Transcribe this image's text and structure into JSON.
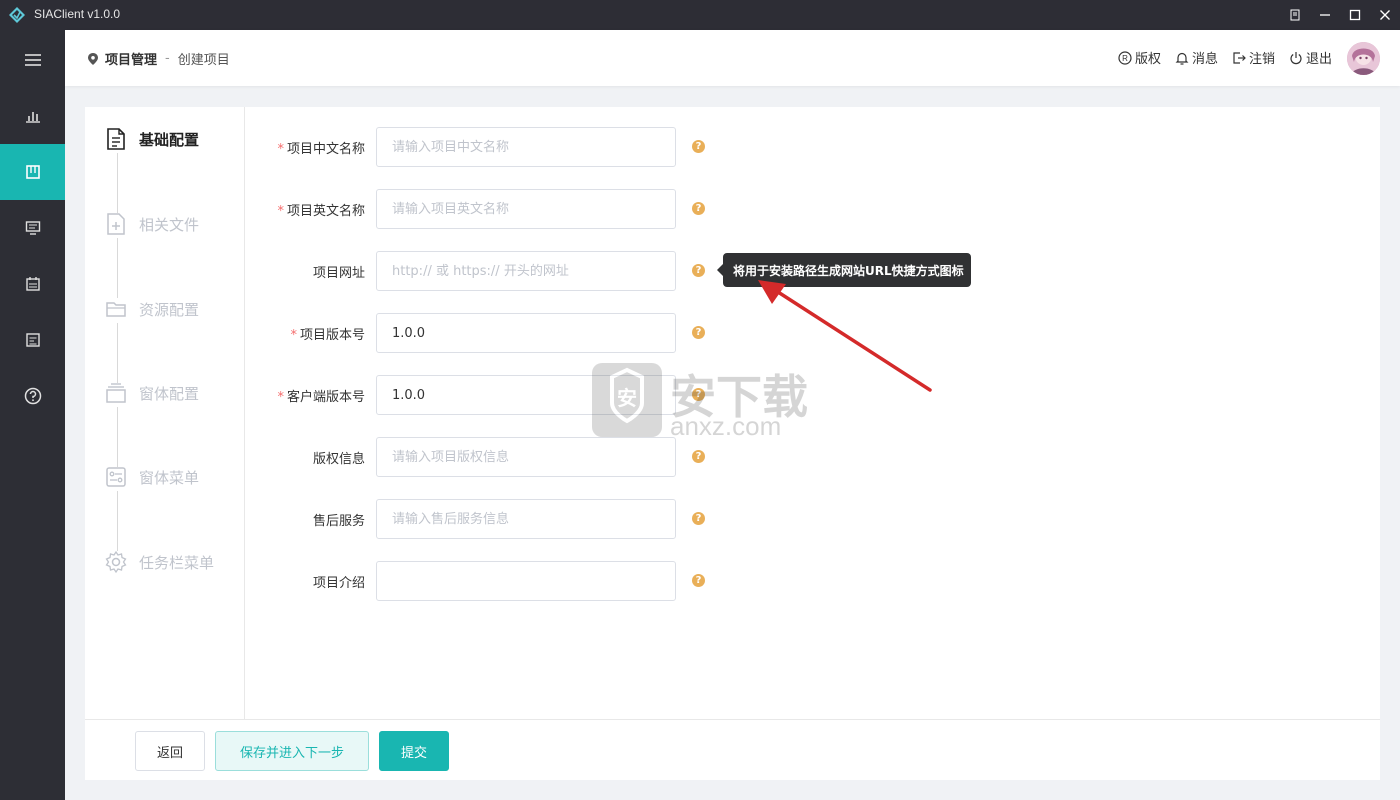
{
  "app": {
    "title": "SIAClient v1.0.0"
  },
  "colors": {
    "accent": "#19b6b1",
    "sidebar": "#2d2e35",
    "required": "#f56c6c",
    "help": "#e6a23c",
    "arrow": "#d42a2a"
  },
  "sidebar": {
    "items": [
      {
        "icon": "menu-icon"
      },
      {
        "icon": "bar-chart-icon"
      },
      {
        "icon": "project-icon",
        "active": true
      },
      {
        "icon": "monitor-icon"
      },
      {
        "icon": "calendar-icon"
      },
      {
        "icon": "document-icon"
      },
      {
        "icon": "help-circle-icon"
      }
    ]
  },
  "header": {
    "breadcrumb": {
      "primary": "项目管理",
      "separator": "-",
      "secondary": "创建项目"
    },
    "actions": [
      {
        "label": "版权",
        "icon": "copyright-icon"
      },
      {
        "label": "消息",
        "icon": "bell-icon"
      },
      {
        "label": "注销",
        "icon": "logout-icon"
      },
      {
        "label": "退出",
        "icon": "power-icon"
      }
    ]
  },
  "steps": [
    {
      "label": "基础配置",
      "icon": "document-icon",
      "active": true
    },
    {
      "label": "相关文件",
      "icon": "file-add-icon"
    },
    {
      "label": "资源配置",
      "icon": "folder-icon"
    },
    {
      "label": "窗体配置",
      "icon": "window-icon"
    },
    {
      "label": "窗体菜单",
      "icon": "menu-settings-icon"
    },
    {
      "label": "任务栏菜单",
      "icon": "gear-icon"
    }
  ],
  "form": {
    "fields": [
      {
        "label": "项目中文名称",
        "required": true,
        "value": "",
        "placeholder": "请输入项目中文名称"
      },
      {
        "label": "项目英文名称",
        "required": true,
        "value": "",
        "placeholder": "请输入项目英文名称"
      },
      {
        "label": "项目网址",
        "required": false,
        "value": "",
        "placeholder": "http:// 或 https:// 开头的网址"
      },
      {
        "label": "项目版本号",
        "required": true,
        "value": "1.0.0",
        "placeholder": ""
      },
      {
        "label": "客户端版本号",
        "required": true,
        "value": "1.0.0",
        "placeholder": ""
      },
      {
        "label": "版权信息",
        "required": false,
        "value": "",
        "placeholder": "请输入项目版权信息"
      },
      {
        "label": "售后服务",
        "required": false,
        "value": "",
        "placeholder": "请输入售后服务信息"
      },
      {
        "label": "项目介绍",
        "required": false,
        "value": "",
        "placeholder": ""
      }
    ],
    "required_mark": "*",
    "help_glyph": "?"
  },
  "tooltip": {
    "text": "将用于安装路径生成网站URL快捷方式图标"
  },
  "watermark": {
    "brand": "安下载",
    "domain": "anxz.com"
  },
  "footer": {
    "back_label": "返回",
    "save_next_label": "保存并进入下一步",
    "submit_label": "提交"
  }
}
